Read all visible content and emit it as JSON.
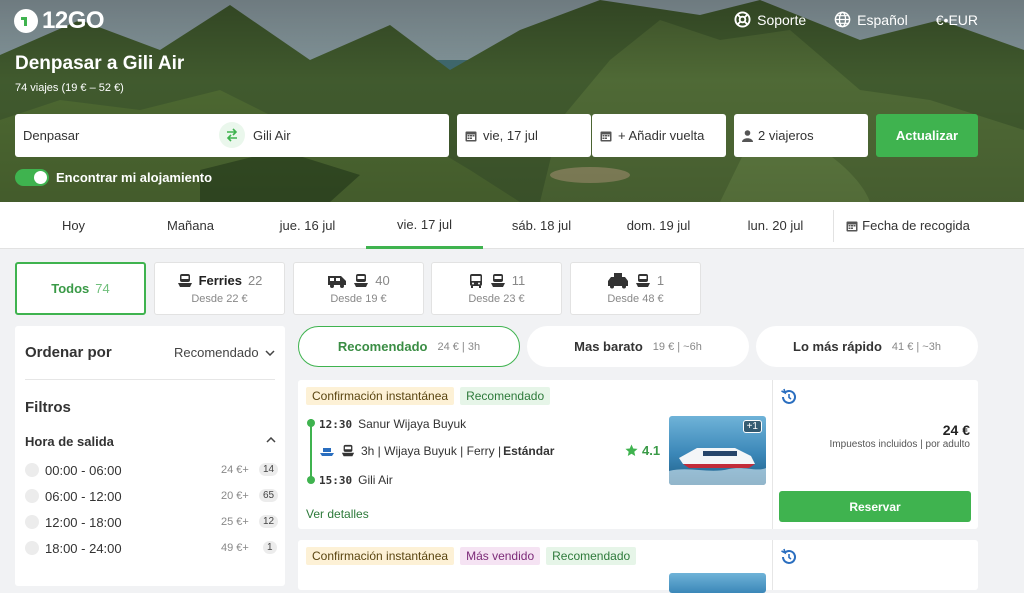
{
  "header": {
    "logo_text": "12GO",
    "nav": {
      "support": "Soporte",
      "language": "Español",
      "currency": "€•EUR"
    },
    "title": "Denpasar a Gili Air",
    "subtitle": "74 viajes (19 € – 52 €)"
  },
  "search": {
    "from": "Denpasar",
    "to": "Gili Air",
    "date": "vie, 17 jul",
    "return": "+ Añadir vuelta",
    "travelers": "2 viajeros",
    "update_button": "Actualizar",
    "accommodation_toggle": "Encontrar mi alojamiento"
  },
  "dates": [
    "Hoy",
    "Mañana",
    "jue. 16 jul",
    "vie. 17 jul",
    "sáb. 18 jul",
    "dom. 19 jul",
    "lun. 20 jul"
  ],
  "pickup_date": "Fecha de recogida",
  "transport_tabs": [
    {
      "label": "Todos",
      "count": "74"
    },
    {
      "label": "Ferries",
      "count": "22",
      "from": "Desde 22 €"
    },
    {
      "count": "40",
      "from": "Desde 19 €"
    },
    {
      "count": "11",
      "from": "Desde 23 €"
    },
    {
      "count": "1",
      "from": "Desde 48 €"
    }
  ],
  "sidebar": {
    "sort_label": "Ordenar por",
    "sort_value": "Recomendado",
    "filters_title": "Filtros",
    "departure_title": "Hora de salida",
    "slots": [
      {
        "range": "00:00 - 06:00",
        "price": "24 €+",
        "count": "14"
      },
      {
        "range": "06:00 - 12:00",
        "price": "20 €+",
        "count": "65"
      },
      {
        "range": "12:00 - 18:00",
        "price": "25 €+",
        "count": "12"
      },
      {
        "range": "18:00 - 24:00",
        "price": "49 €+",
        "count": "1"
      }
    ]
  },
  "sort_tabs": [
    {
      "label": "Recomendado",
      "meta": "24 € | 3h"
    },
    {
      "label": "Mas barato",
      "meta": "19 € | ~6h"
    },
    {
      "label": "Lo más rápido",
      "meta": "41 € | ~3h"
    }
  ],
  "results": [
    {
      "badges": [
        "Confirmación instantánea",
        "Recomendado"
      ],
      "dep_time": "12:30",
      "dep_station": "Sanur Wijaya Buyuk",
      "details": "3h | Wijaya Buyuk | Ferry | ",
      "class": "Estándar",
      "rating": "4.1",
      "arr_time": "15:30",
      "arr_station": "Gili Air",
      "photo_count": "+1",
      "price": "24 €",
      "price_note": "Impuestos incluidos | por adulto",
      "book_button": "Reservar",
      "details_link": "Ver detalles"
    },
    {
      "badges": [
        "Confirmación instantánea",
        "Más vendido",
        "Recomendado"
      ]
    }
  ],
  "colors": {
    "accent": "#3fb34f",
    "badge_instant": "#fdf1d6",
    "badge_rec": "#e6f5e8",
    "badge_sold": "#f5e3f3"
  }
}
